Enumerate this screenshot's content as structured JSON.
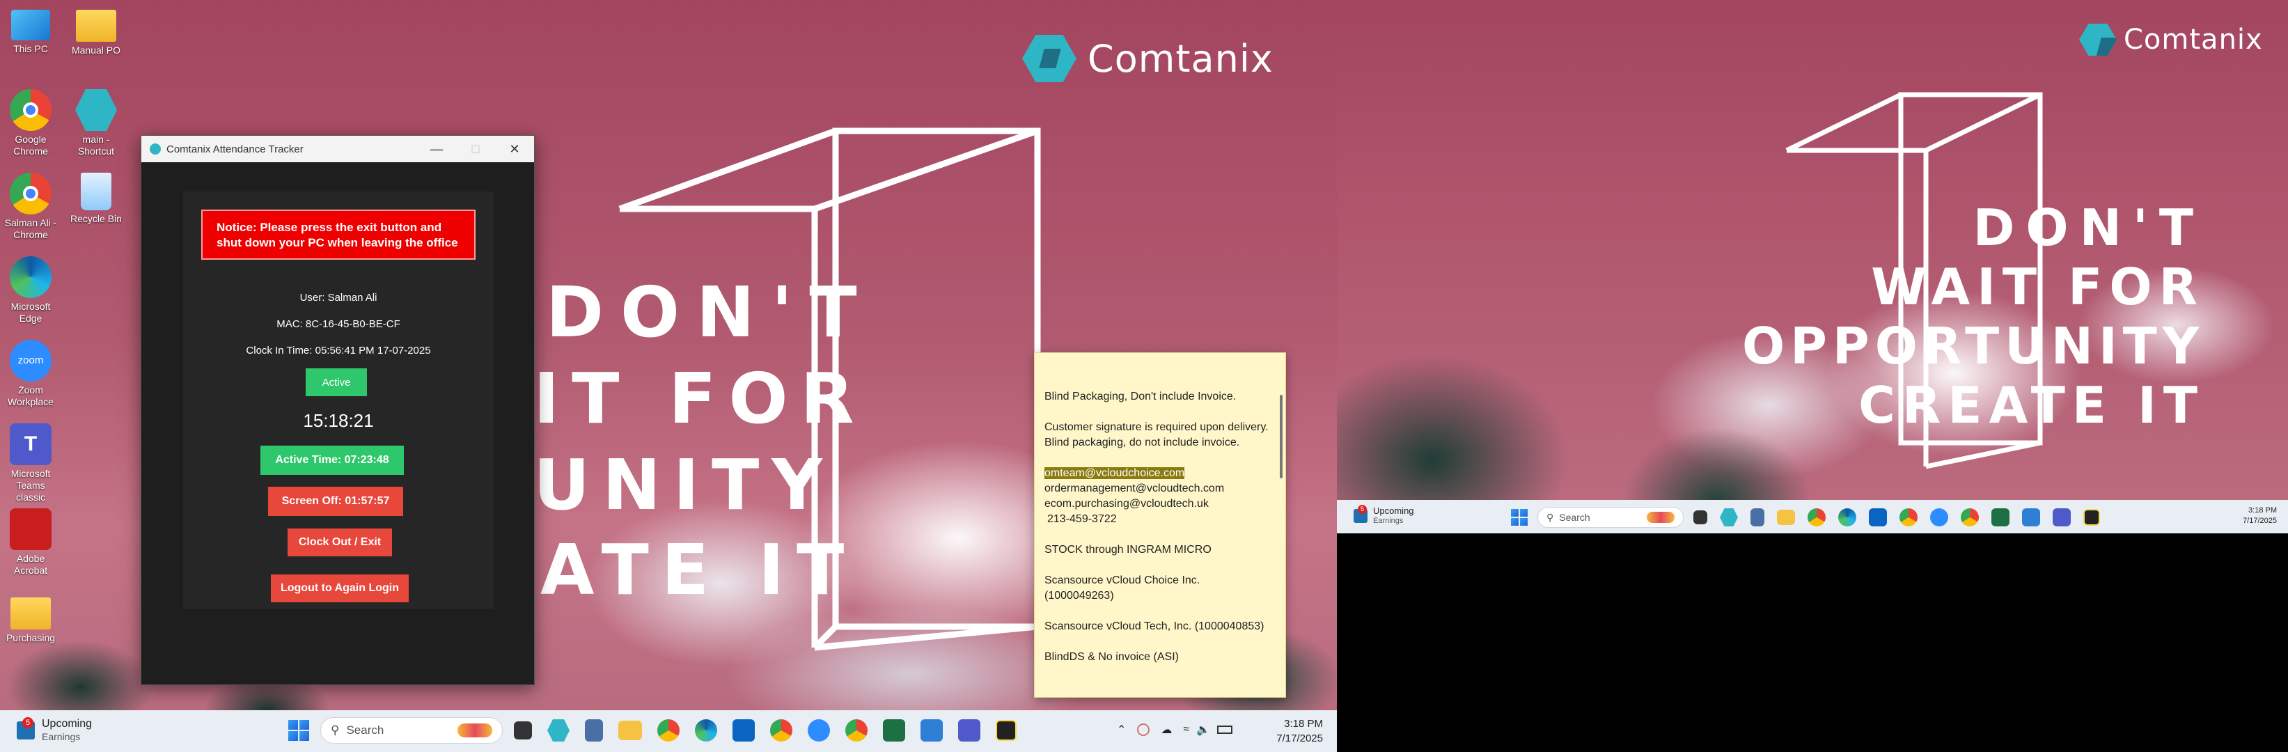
{
  "desktop": {
    "brand": "Comtanix",
    "slogan_lines_monitor1": [
      "DON'T",
      "IT FOR",
      "UNITY",
      "ATE IT"
    ],
    "slogan_lines_monitor2": [
      "DON'T",
      "WAIT FOR",
      "OPPORTUNITY",
      "CREATE IT"
    ],
    "icons": [
      {
        "label": "This PC",
        "icon": "computer-icon"
      },
      {
        "label": "Manual PO",
        "icon": "folder-icon"
      },
      {
        "label": "Google Chrome",
        "icon": "chrome-icon"
      },
      {
        "label": "main - Shortcut",
        "icon": "comtanix-app-icon"
      },
      {
        "label": "Salman Ali - Chrome",
        "icon": "chrome-icon"
      },
      {
        "label": "Recycle Bin",
        "icon": "recycle-bin-icon"
      },
      {
        "label": "Microsoft Edge",
        "icon": "edge-icon"
      },
      {
        "label": "Zoom Workplace",
        "icon": "zoom-icon"
      },
      {
        "label": "Microsoft Teams classic",
        "icon": "teams-icon"
      },
      {
        "label": "Adobe Acrobat",
        "icon": "acrobat-icon"
      },
      {
        "label": "Purchasing",
        "icon": "folder-icon"
      }
    ]
  },
  "attendance_window": {
    "title": "Comtanix Attendance Tracker",
    "notice": "Notice: Please press the exit button and shut down your PC when leaving the office",
    "user": "User: Salman Ali",
    "mac": "MAC: 8C-16-45-B0-BE-CF",
    "clock_in": "Clock In Time: 05:56:41 PM 17-07-2025",
    "status_button": "Active",
    "current_time": "15:18:21",
    "active_time": "Active Time: 07:23:48",
    "screen_off": "Screen Off: 01:57:57",
    "clock_out_button": "Clock Out / Exit",
    "logout_button": "Logout to Again Login"
  },
  "sticky_note": {
    "para1": "Blind Packaging, Don't include Invoice.",
    "para2": "Customer signature is required upon delivery. Blind packaging, do not include invoice.",
    "email_highlight": "omteam@vcloudchoice.com",
    "email2": "ordermanagement@vcloudtech.com",
    "email3": "ecom.purchasing@vcloudtech.uk",
    "phone": "213-459-3722",
    "stock": "STOCK through INGRAM MICRO",
    "scansource1": "Scansource vCloud Choice Inc. (1000049263)",
    "scansource2": "Scansource vCloud Tech, Inc. (1000040853)",
    "cutoff": "BlindDS & No invoice (ASI)"
  },
  "taskbar": {
    "weather_title": "Upcoming",
    "weather_sub": "Earnings",
    "weather_badge": "5",
    "search_placeholder": "Search",
    "time": "3:18 PM",
    "date": "7/17/2025"
  },
  "colors": {
    "accent_green": "#2ec76b",
    "danger_red": "#e8473c",
    "notice_red": "#ee0000",
    "brand_teal": "#2fb6c6"
  }
}
